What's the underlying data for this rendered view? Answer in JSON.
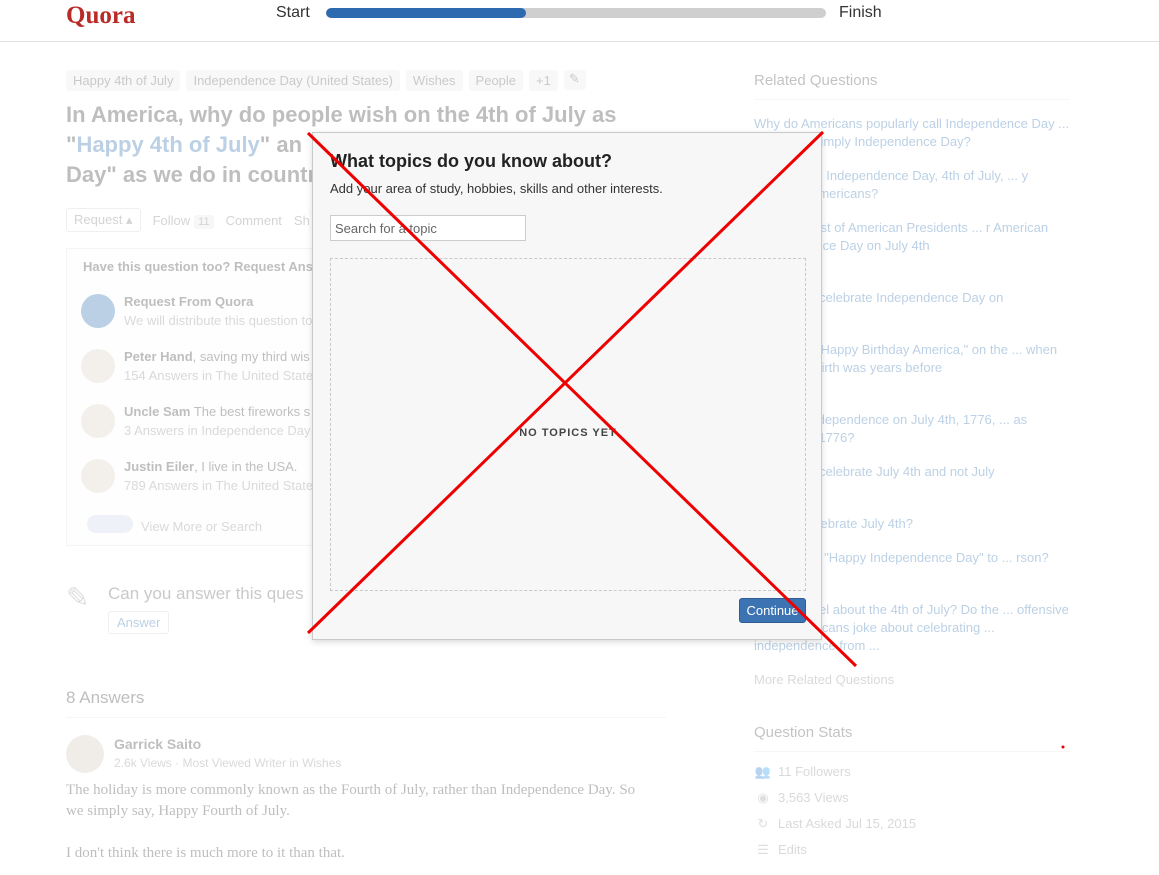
{
  "header": {
    "logo": "Quora",
    "progress_start": "Start",
    "progress_finish": "Finish",
    "progress_fraction": 0.4
  },
  "question": {
    "tags": [
      "Happy 4th of July",
      "Independence Day (United States)",
      "Wishes",
      "People",
      "+1"
    ],
    "title_part1": "In America, why do people wish on the 4th of July as \"",
    "title_link": "Happy 4th of July",
    "title_part2": "\" an",
    "title_line3": "Day\" as we do in countr",
    "actions": {
      "request": "Request ▴",
      "follow": "Follow",
      "follow_count": "11",
      "comment": "Comment",
      "share": "Sh"
    }
  },
  "request_box": {
    "heading": "Have this question too? Request Ans",
    "items": [
      {
        "name": "Request From Quora",
        "desc": "",
        "sub": "We will distribute this question to"
      },
      {
        "name": "Peter Hand",
        "desc": ", saving my third wis",
        "sub": "154 Answers in The United State"
      },
      {
        "name": "Uncle Sam",
        "desc": " The best fireworks s",
        "sub": "3 Answers in Independence Day"
      },
      {
        "name": "Justin Eiler",
        "desc": ", I live in the USA.",
        "sub": "789 Answers in The United State"
      }
    ],
    "view_more": "View More or Search"
  },
  "answer_prompt": {
    "text": "Can you answer this ques",
    "button": "Answer"
  },
  "answers": {
    "heading": "8 Answers",
    "first": {
      "author": "Garrick Saito",
      "meta": "2.6k Views · Most Viewed Writer in Wishes",
      "body_line1": "The holiday is more commonly known as the Fourth of July, rather than Independence Day.  So we simply say, Happy Fourth of July.",
      "body_line2": "I don't think there is much more to it than that."
    }
  },
  "related": {
    "heading": "Related Questions",
    "items": [
      "Why do Americans popularly call Independence Day ... ly and not simply Independence Day?",
      "... American Independence Day, 4th of July, ... y overseas Americans?",
      "... find the list of American Presidents ... r American Independence Day on July 4th",
      "... America celebrate Independence Day on",
      "... ple say, \"Happy Birthday America,\" on the ... when America's birth was years before",
      "... clared independence on July 4th, 1776, ... as founded in 1776?",
      "... America celebrate July 4th and not July",
      "... eople celebrate July 4th?",
      "... as to say \"Happy Independence Day\" to ... rson?",
      "... British feel about the 4th of July? Do the ... offensive when Americans joke about celebrating ... independence from ..."
    ],
    "more": "More Related Questions"
  },
  "stats": {
    "heading": "Question Stats",
    "followers": "11 Followers",
    "views": "3,563 Views",
    "last_asked": "Last Asked Jul 15, 2015",
    "edits": "Edits"
  },
  "modal": {
    "title": "What topics do you know about?",
    "subtitle": "Add your area of study, hobbies, skills and other interests.",
    "search_placeholder": "Search for a topic",
    "empty_label": "NO TOPICS YET",
    "continue_label": "Continue"
  }
}
